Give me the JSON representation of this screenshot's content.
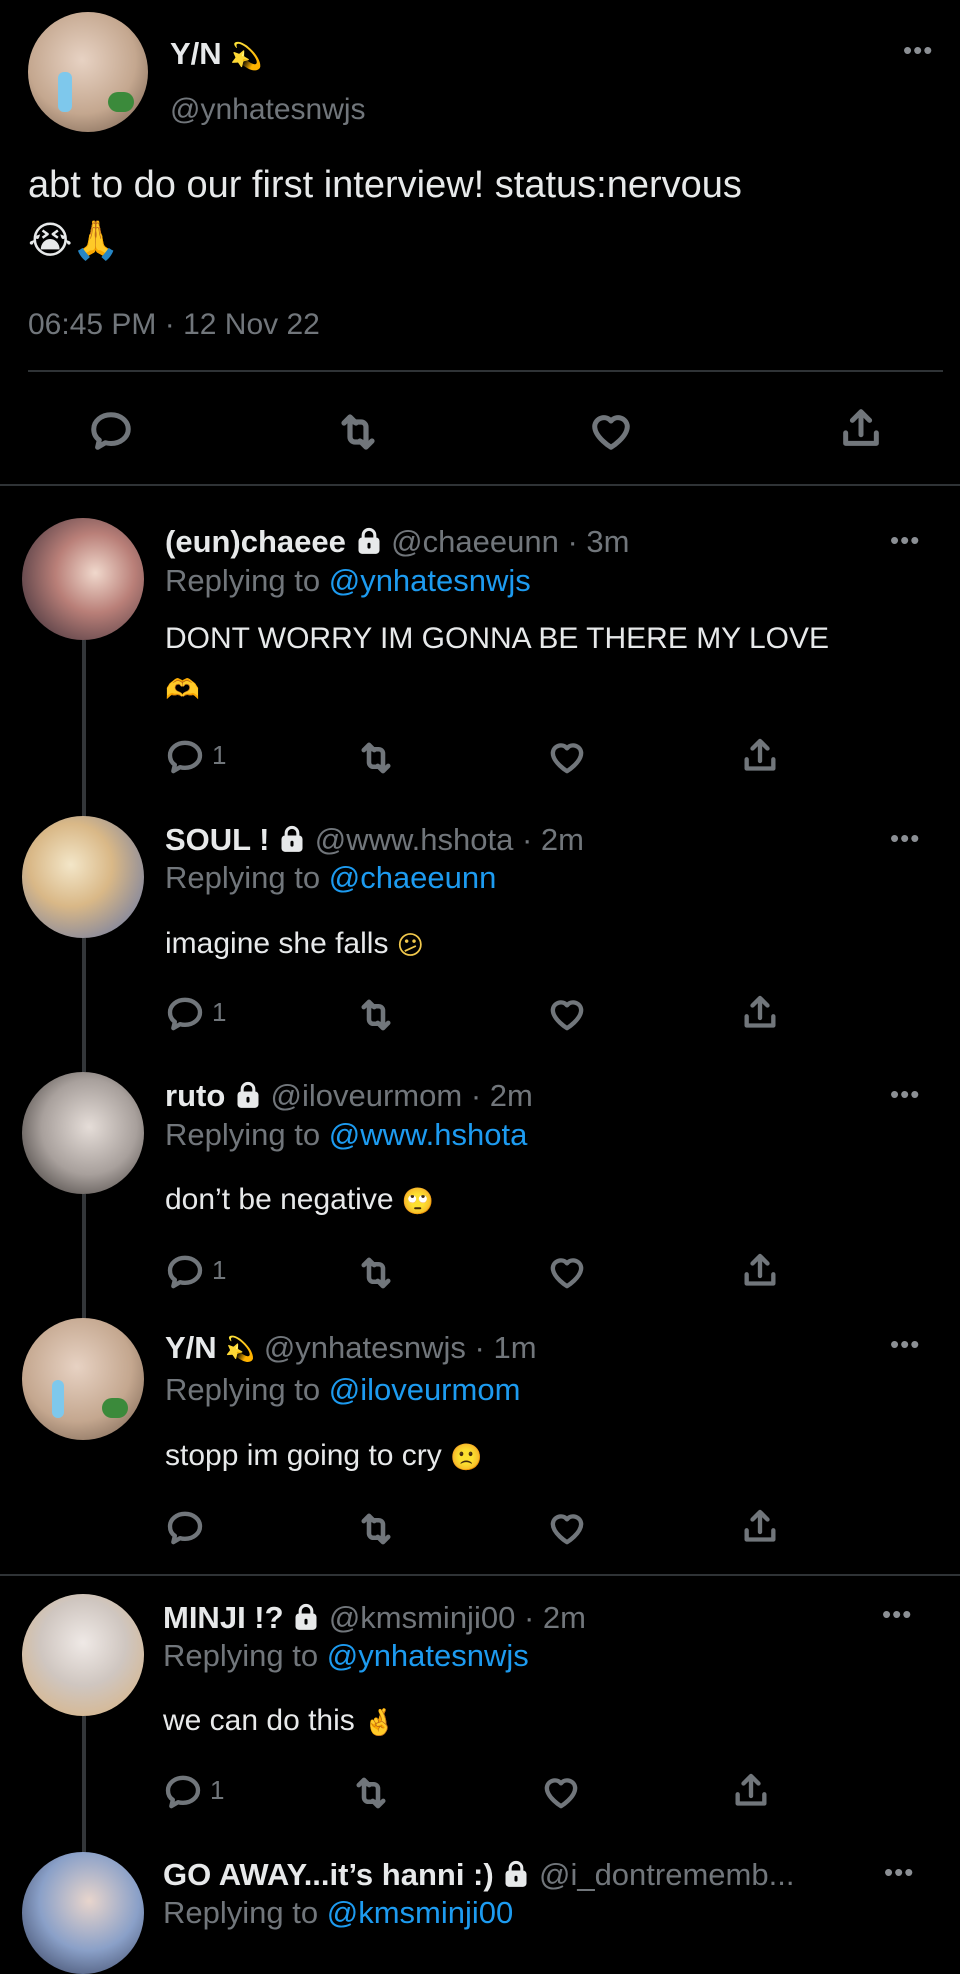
{
  "main_tweet": {
    "display_name": "Y/N",
    "handle": "@ynhatesnwjs",
    "text": "abt to do our first interview! status:nervous",
    "timestamp": "06:45 PM · 12 Nov 22"
  },
  "replies": [
    {
      "display_name": "(eun)chaeee",
      "handle": "@chaeeunn",
      "time": "· 3m",
      "replying_label": "Replying to",
      "replying_to": "@ynhatesnwjs",
      "text": "DONT WORRY IM GONNA BE THERE MY LOVE",
      "reply_count": "1",
      "locked": true
    },
    {
      "display_name": "SOUL !",
      "handle": "@www.hshota",
      "time": "· 2m",
      "replying_label": "Replying to",
      "replying_to": "@chaeeunn",
      "text": "imagine she falls",
      "reply_count": "1",
      "locked": true
    },
    {
      "display_name": "ruto",
      "handle": "@iloveurmom",
      "time": "· 2m",
      "replying_label": "Replying to",
      "replying_to": "@www.hshota",
      "text": "don’t be negative",
      "reply_count": "1",
      "locked": true
    },
    {
      "display_name": "Y/N",
      "handle": "@ynhatesnwjs",
      "time": "· 1m",
      "replying_label": "Replying to",
      "replying_to": "@iloveurmom",
      "text": "stopp im going to cry",
      "reply_count": "",
      "locked": false
    },
    {
      "display_name": "MINJI !?",
      "handle": "@kmsminji00",
      "time": "· 2m",
      "replying_label": "Replying to",
      "replying_to": "@ynhatesnwjs",
      "text": "we can do this",
      "reply_count": "1",
      "locked": true
    },
    {
      "display_name": "GO AWAY...it’s hanni :)",
      "handle": "@i_dontrememb...",
      "time": "",
      "replying_label": "Replying to",
      "replying_to": "@kmsminji00",
      "text": "",
      "reply_count": "",
      "locked": true
    }
  ],
  "icons": [
    "reply-icon",
    "retweet-icon",
    "like-icon",
    "share-icon",
    "lock-icon",
    "more-icon"
  ],
  "colors": {
    "background": "#000000",
    "text": "#e7e9ea",
    "muted": "#71767b",
    "link": "#1d9bf0",
    "divider": "#2f3336"
  }
}
